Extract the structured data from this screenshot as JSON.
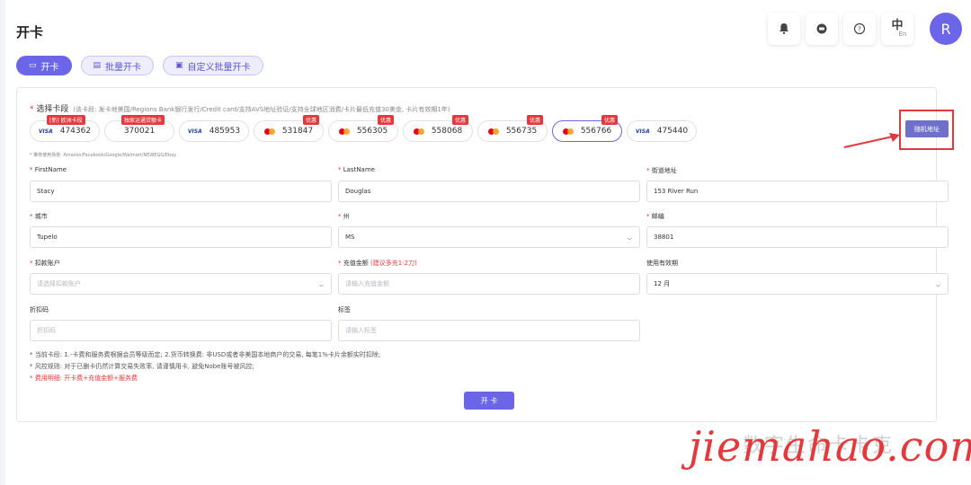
{
  "page": {
    "title": "开卡"
  },
  "header": {
    "bell_icon": "bell-icon",
    "chat_icon": "chat-icon",
    "help_icon": "question-icon",
    "lang_zh": "中",
    "lang_en": "En",
    "avatar_letter": "R"
  },
  "tabs": [
    {
      "label": "开卡",
      "icon": "▭"
    },
    {
      "label": "批量开卡",
      "icon": "▤"
    },
    {
      "label": "自定义批量开卡",
      "icon": "▣"
    }
  ],
  "card_segment": {
    "label": "选择卡段",
    "note": "(该卡段: 发卡地美国/Regions Bank银行发行/Credit card/支持AVS地址验证/支持全球地区消费/卡片最低充值30美金, 卡片有效期1年)",
    "bins": [
      {
        "brand": "VISA",
        "number": "474362",
        "badge": "[新] 欧洲卡段"
      },
      {
        "brand": "",
        "number": "370021",
        "badge": "独家运通贷额卡"
      },
      {
        "brand": "VISA",
        "number": "485953",
        "badge": ""
      },
      {
        "brand": "MC",
        "number": "531847",
        "badge": "优惠"
      },
      {
        "brand": "MC",
        "number": "556305",
        "badge": "优惠"
      },
      {
        "brand": "MC",
        "number": "558068",
        "badge": "优惠"
      },
      {
        "brand": "MC",
        "number": "556735",
        "badge": "优惠"
      },
      {
        "brand": "MC",
        "number": "556766",
        "badge": "优惠"
      },
      {
        "brand": "VISA",
        "number": "475440",
        "badge": ""
      }
    ],
    "hint": "* 推荐使用场景: Amazon/Facebook/Google/Walmart/NEWEGG/Ebay"
  },
  "random_address_label": "随机地址",
  "form": {
    "first_name": {
      "label": "FirstName",
      "value": "Stacy"
    },
    "last_name": {
      "label": "LastName",
      "value": "Douglas"
    },
    "street": {
      "label": "街道地址",
      "value": "153 River Run"
    },
    "city": {
      "label": "城市",
      "value": "Tupelo"
    },
    "state": {
      "label": "州",
      "value": "MS"
    },
    "zip": {
      "label": "邮编",
      "value": "38801"
    },
    "account": {
      "label": "扣款账户",
      "placeholder": "请选择扣款账户"
    },
    "amount": {
      "label": "充值金额",
      "tip": "(建议多充1-2刀)",
      "placeholder": "请输入充值金额"
    },
    "expiry": {
      "label": "使用有效期",
      "value": "12 月"
    },
    "discount": {
      "label": "折扣码",
      "placeholder": "折扣码"
    },
    "tag": {
      "label": "标签",
      "placeholder": "请输入标签"
    }
  },
  "notes": {
    "line1": "* 当前卡段: 1.-卡费和服务费根据会员等级而定; 2.货币转换费: 非USD或者非美国本地商户的交易, 每笔1%卡片余额实时扣除;",
    "line2": "* 风控规则: 对于已删卡仍然计算交易失败率, 请谨慎用卡, 避免Nobe账号被风控;",
    "line3": "* 费用明细: 开卡费+充值金额+服务费"
  },
  "submit_label": "开 卡",
  "watermark": {
    "cn": "数字生命卡卡克",
    "en": "jiemahao.com"
  },
  "colors": {
    "accent": "#6b66e8",
    "danger": "#e4393c"
  }
}
